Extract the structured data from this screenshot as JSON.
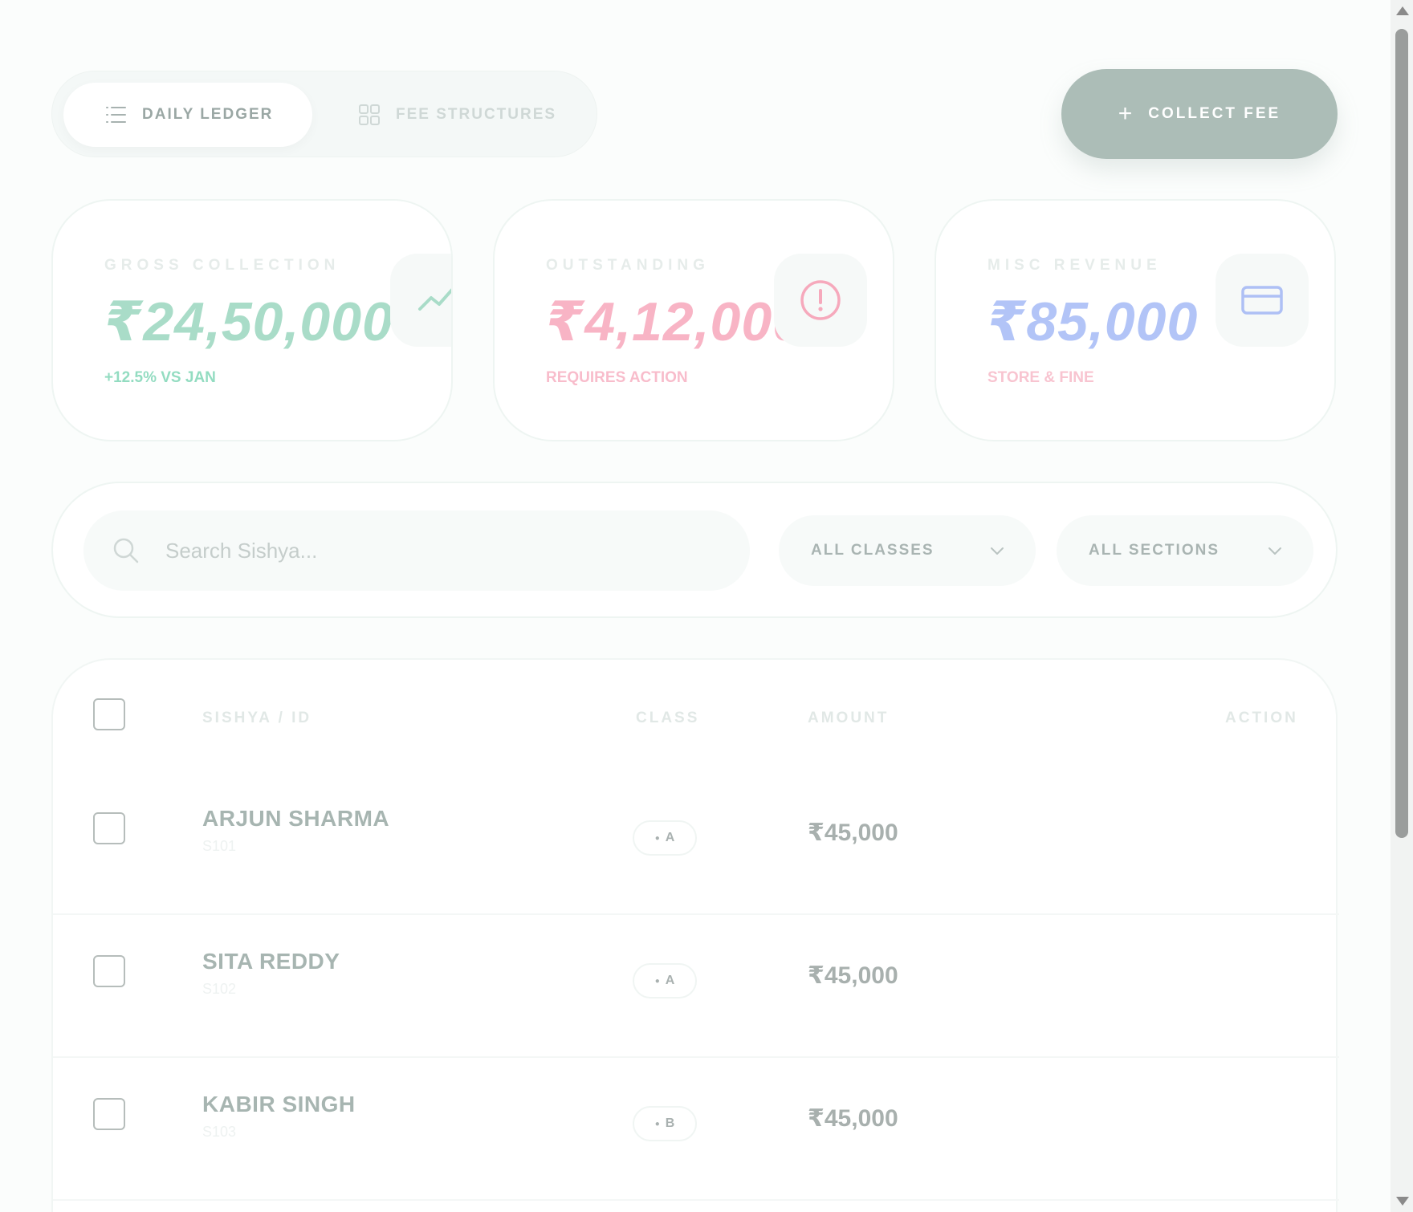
{
  "tabs": {
    "daily_ledger": "DAILY LEDGER",
    "fee_structures": "FEE STRUCTURES"
  },
  "collect_button": {
    "plus": "+",
    "label": "COLLECT FEE"
  },
  "stats": [
    {
      "label": "GROSS COLLECTION",
      "value": "₹24,50,000",
      "sub": "+12.5% VS JAN",
      "color": "#a9dcc8",
      "sub_color": "#93dcc1",
      "icon": "trending-up-icon"
    },
    {
      "label": "OUTSTANDING",
      "value": "₹4,12,000",
      "sub": "REQUIRES ACTION",
      "color": "#f8b4c5",
      "sub_color": "#f8bccb",
      "icon": "alert-circle-icon"
    },
    {
      "label": "MISC REVENUE",
      "value": "₹85,000",
      "sub": "STORE & FINE",
      "color": "#b2c4f7",
      "sub_color": "#f8c4d0",
      "icon": "credit-card-icon"
    }
  ],
  "filters": {
    "search_placeholder": "Search Sishya...",
    "class_select": "ALL CLASSES",
    "section_select": "ALL SECTIONS"
  },
  "table": {
    "headers": {
      "student": "SISHYA / ID",
      "class": "CLASS",
      "amount": "AMOUNT",
      "action": "ACTION"
    },
    "rows": [
      {
        "name": "ARJUN SHARMA",
        "id": "S101",
        "class": "A",
        "amount": "₹45,000"
      },
      {
        "name": "SITA REDDY",
        "id": "S102",
        "class": "A",
        "amount": "₹45,000"
      },
      {
        "name": "KABIR SINGH",
        "id": "S103",
        "class": "B",
        "amount": "₹45,000"
      }
    ]
  }
}
